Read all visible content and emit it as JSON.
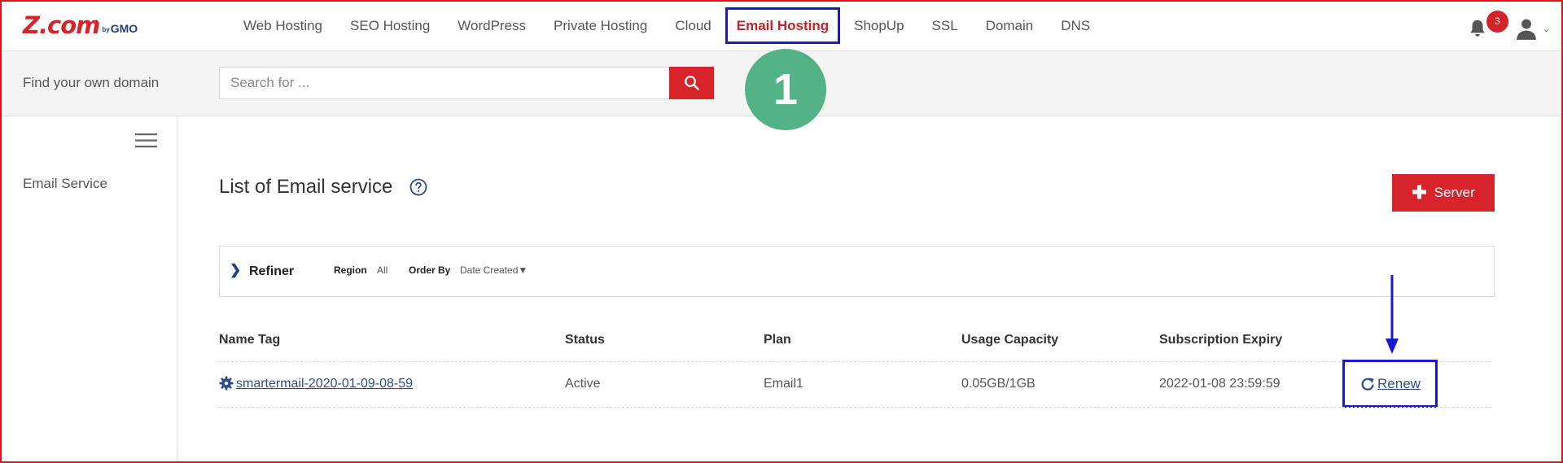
{
  "brand": {
    "logo_main": "Z.com",
    "logo_by": "by",
    "logo_gmo": "GMO",
    "accent": "#d7242a",
    "navy": "#1e3f8c"
  },
  "nav": {
    "items": [
      {
        "label": "Web Hosting"
      },
      {
        "label": "SEO Hosting"
      },
      {
        "label": "WordPress"
      },
      {
        "label": "Private Hosting"
      },
      {
        "label": "Cloud"
      },
      {
        "label": "Email Hosting",
        "active": true
      },
      {
        "label": "ShopUp"
      },
      {
        "label": "SSL"
      },
      {
        "label": "Domain"
      },
      {
        "label": "DNS"
      }
    ],
    "notification_count": "3"
  },
  "search": {
    "label": "Find your own domain",
    "placeholder": "Search for ..."
  },
  "annotation": {
    "step": "1",
    "step_color": "#54b386",
    "highlight_color": "#1a1acc"
  },
  "sidebar": {
    "items": [
      {
        "label": "Email Service"
      }
    ]
  },
  "main": {
    "title": "List of Email service",
    "add_button": "Server",
    "refiner": {
      "title": "Refiner",
      "region_label": "Region",
      "region_value": "All",
      "orderby_label": "Order By",
      "orderby_value": "Date Created▼"
    },
    "table": {
      "headers": [
        "Name Tag",
        "Status",
        "Plan",
        "Usage Capacity",
        "Subscription Expiry"
      ],
      "rows": [
        {
          "name": " smartermail-2020-01-09-08-59",
          "status": "Active",
          "plan": "Email1",
          "usage": "0.05GB/1GB",
          "expiry": "2022-01-08 23:59:59",
          "action": "Renew"
        }
      ]
    }
  }
}
